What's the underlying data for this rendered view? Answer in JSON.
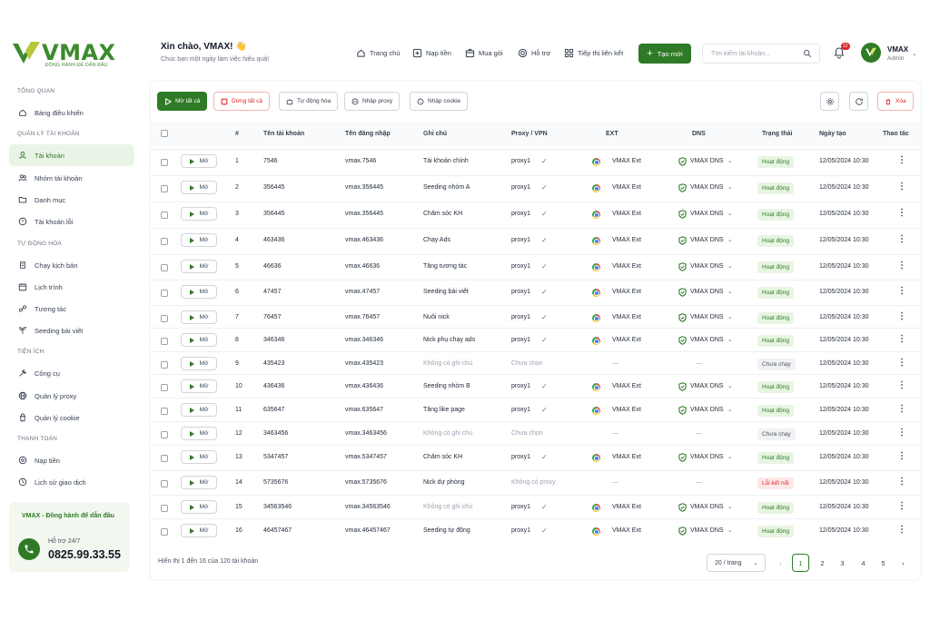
{
  "brand": {
    "name": "VMAX",
    "tagline": "ĐỒNG HÀNH ĐỂ DẪN ĐẦU",
    "accent": "#2f7a26"
  },
  "sidebar": {
    "sections": [
      {
        "title": "TỔNG QUAN",
        "items": [
          {
            "label": "Bảng điều khiển",
            "icon": "home-icon"
          }
        ]
      },
      {
        "title": "QUẢN LÝ TÀI KHOẢN",
        "items": [
          {
            "label": "Tài khoản",
            "icon": "user-icon",
            "active": true
          },
          {
            "label": "Nhóm tài khoản",
            "icon": "users-icon"
          },
          {
            "label": "Danh mục",
            "icon": "folder-icon"
          },
          {
            "label": "Tài khoản lỗi",
            "icon": "alert-icon"
          }
        ]
      },
      {
        "title": "TỰ ĐỘNG HÓA",
        "items": [
          {
            "label": "Chạy kịch bản",
            "icon": "script-icon"
          },
          {
            "label": "Lịch trình",
            "icon": "calendar-icon"
          },
          {
            "label": "Tương tác",
            "icon": "interact-icon"
          },
          {
            "label": "Seeding bài viết",
            "icon": "seeding-icon"
          }
        ]
      },
      {
        "title": "TIỆN ÍCH",
        "items": [
          {
            "label": "Công cụ",
            "icon": "tool-icon"
          },
          {
            "label": "Quản lý proxy",
            "icon": "globe-icon"
          },
          {
            "label": "Quản lý cookie",
            "icon": "cookie-icon"
          }
        ]
      },
      {
        "title": "THANH TOÁN",
        "items": [
          {
            "label": "Nạp tiền",
            "icon": "wallet-icon"
          },
          {
            "label": "Lịch sử giao dịch",
            "icon": "history-icon"
          }
        ]
      }
    ],
    "promo": {
      "title": "VMAX - Đồng hành để dẫn đầu",
      "support_label": "Hỗ trợ 24/7",
      "phone": "0825.99.33.55"
    }
  },
  "header": {
    "greeting": "Xin chào, VMAX! 👋",
    "subtitle": "Chúc bạn một ngày làm việc hiệu quả!",
    "nav": [
      {
        "label": "Trang chủ",
        "icon": "home-icon"
      },
      {
        "label": "Nạp tiền",
        "icon": "plus-square-icon"
      },
      {
        "label": "Mua gói",
        "icon": "package-icon"
      },
      {
        "label": "Hỗ trợ",
        "icon": "support-icon"
      },
      {
        "label": "Tiếp thị liên kết",
        "icon": "affiliate-icon"
      }
    ],
    "create_label": "Tạo mới",
    "search_placeholder": "Tìm kiếm tài khoản...",
    "notification_count": "12",
    "user": {
      "name": "VMAX",
      "role": "Admin"
    }
  },
  "toolbar": {
    "open_all": "Mở tất cả",
    "stop_all": "Dừng tất cả",
    "automation": "Tự động hóa",
    "import_proxy": "Nhập proxy",
    "import_cookie": "Nhập cookie",
    "delete": "Xóa"
  },
  "table": {
    "columns": [
      "#",
      "Tên tài khoản",
      "Tên đăng nhập",
      "Ghi chú",
      "Proxy / VPN",
      "EXT",
      "DNS",
      "Trạng thái",
      "Ngày tạo",
      "Thao tác"
    ],
    "open_label": "Mở",
    "rows": [
      {
        "no": "1",
        "name": "7546",
        "login": "vmax.7546",
        "note": "Tài khoản chính",
        "note_muted": false,
        "proxy": "proxy1",
        "proxy_ok": true,
        "ext": "VMAX Ext",
        "dns": "VMAX DNS",
        "status": "Hoạt động",
        "status_type": "ok",
        "created": "12/05/2024 10:30"
      },
      {
        "no": "2",
        "name": "356445",
        "login": "vmax.356445",
        "note": "Seeding nhóm A",
        "note_muted": false,
        "proxy": "proxy1",
        "proxy_ok": true,
        "ext": "VMAX Ext",
        "dns": "VMAX DNS",
        "status": "Hoạt động",
        "status_type": "ok",
        "created": "12/05/2024 10:30"
      },
      {
        "no": "3",
        "name": "356445",
        "login": "vmax.356445",
        "note": "Chăm sóc KH",
        "note_muted": false,
        "proxy": "proxy1",
        "proxy_ok": true,
        "ext": "VMAX Ext",
        "dns": "VMAX DNS",
        "status": "Hoạt động",
        "status_type": "ok",
        "created": "12/05/2024 10:30"
      },
      {
        "no": "4",
        "name": "463436",
        "login": "vmax.463436",
        "note": "Chạy Ads",
        "note_muted": false,
        "proxy": "proxy1",
        "proxy_ok": true,
        "ext": "VMAX Ext",
        "dns": "VMAX DNS",
        "status": "Hoạt động",
        "status_type": "ok",
        "created": "12/05/2024 10:30"
      },
      {
        "no": "5",
        "name": "46636",
        "login": "vmax.46636",
        "note": "Tăng tương tác",
        "note_muted": false,
        "proxy": "proxy1",
        "proxy_ok": true,
        "ext": "VMAX Ext",
        "dns": "VMAX DNS",
        "status": "Hoạt động",
        "status_type": "ok",
        "created": "12/05/2024 10:30"
      },
      {
        "no": "6",
        "name": "47457",
        "login": "vmax.47457",
        "note": "Seeding bài viết",
        "note_muted": false,
        "proxy": "proxy1",
        "proxy_ok": true,
        "ext": "VMAX Ext",
        "dns": "VMAX DNS",
        "status": "Hoạt động",
        "status_type": "ok",
        "created": "12/05/2024 10:30"
      },
      {
        "no": "7",
        "name": "76457",
        "login": "vmax.76457",
        "note": "Nuôi nick",
        "note_muted": false,
        "proxy": "proxy1",
        "proxy_ok": true,
        "ext": "VMAX Ext",
        "dns": "VMAX DNS",
        "status": "Hoạt động",
        "status_type": "ok",
        "created": "12/05/2024 10:30"
      },
      {
        "no": "8",
        "name": "346346",
        "login": "vmax.346346",
        "note": "Nick phụ chạy ads",
        "note_muted": false,
        "proxy": "proxy1",
        "proxy_ok": true,
        "ext": "VMAX Ext",
        "dns": "VMAX DNS",
        "status": "Hoạt động",
        "status_type": "ok",
        "created": "12/05/2024 10:30"
      },
      {
        "no": "9",
        "name": "435423",
        "login": "vmax.435423",
        "note": "Không có ghi chú",
        "note_muted": true,
        "proxy": "Chưa chọn",
        "proxy_ok": false,
        "ext": "—",
        "dns": "—",
        "status": "Chưa chạy",
        "status_type": "idle",
        "created": "12/05/2024 10:30"
      },
      {
        "no": "10",
        "name": "436436",
        "login": "vmax.436436",
        "note": "Seeding nhóm B",
        "note_muted": false,
        "proxy": "proxy1",
        "proxy_ok": true,
        "ext": "VMAX Ext",
        "dns": "VMAX DNS",
        "status": "Hoạt động",
        "status_type": "ok",
        "created": "12/05/2024 10:30"
      },
      {
        "no": "11",
        "name": "635647",
        "login": "vmax.635647",
        "note": "Tăng like page",
        "note_muted": false,
        "proxy": "proxy1",
        "proxy_ok": true,
        "ext": "VMAX Ext",
        "dns": "VMAX DNS",
        "status": "Hoạt động",
        "status_type": "ok",
        "created": "12/05/2024 10:30"
      },
      {
        "no": "12",
        "name": "3463456",
        "login": "vmax.3463456",
        "note": "Không có ghi chú",
        "note_muted": true,
        "proxy": "Chưa chọn",
        "proxy_ok": false,
        "ext": "—",
        "dns": "—",
        "status": "Chưa chạy",
        "status_type": "idle",
        "created": "12/05/2024 10:30"
      },
      {
        "no": "13",
        "name": "5347457",
        "login": "vmax.5347457",
        "note": "Chăm sóc KH",
        "note_muted": false,
        "proxy": "proxy1",
        "proxy_ok": true,
        "ext": "VMAX Ext",
        "dns": "VMAX DNS",
        "status": "Hoạt động",
        "status_type": "ok",
        "created": "12/05/2024 10:30"
      },
      {
        "no": "14",
        "name": "5735676",
        "login": "vmax.5735676",
        "note": "Nick dự phòng",
        "note_muted": false,
        "proxy": "Không có proxy",
        "proxy_ok": false,
        "ext": "—",
        "dns": "—",
        "status": "Lỗi kết nối",
        "status_type": "err",
        "created": "12/05/2024 10:30"
      },
      {
        "no": "15",
        "name": "34563546",
        "login": "vmax.34563546",
        "note": "Không có ghi chú",
        "note_muted": true,
        "proxy": "proxy1",
        "proxy_ok": true,
        "ext": "VMAX Ext",
        "dns": "VMAX DNS",
        "status": "Hoạt động",
        "status_type": "ok",
        "created": "12/05/2024 10:30"
      },
      {
        "no": "16",
        "name": "46457467",
        "login": "vmax.46457467",
        "note": "Seeding tự động",
        "note_muted": false,
        "proxy": "proxy1",
        "proxy_ok": true,
        "ext": "VMAX Ext",
        "dns": "VMAX DNS",
        "status": "Hoạt động",
        "status_type": "ok",
        "created": "12/05/2024 10:30"
      }
    ]
  },
  "pagination": {
    "info": "Hiển thị 1 đến 16 của 120 tài khoản",
    "per_page": "20 / trang",
    "pages": [
      "1",
      "2",
      "3",
      "4",
      "5"
    ],
    "current": "1"
  }
}
